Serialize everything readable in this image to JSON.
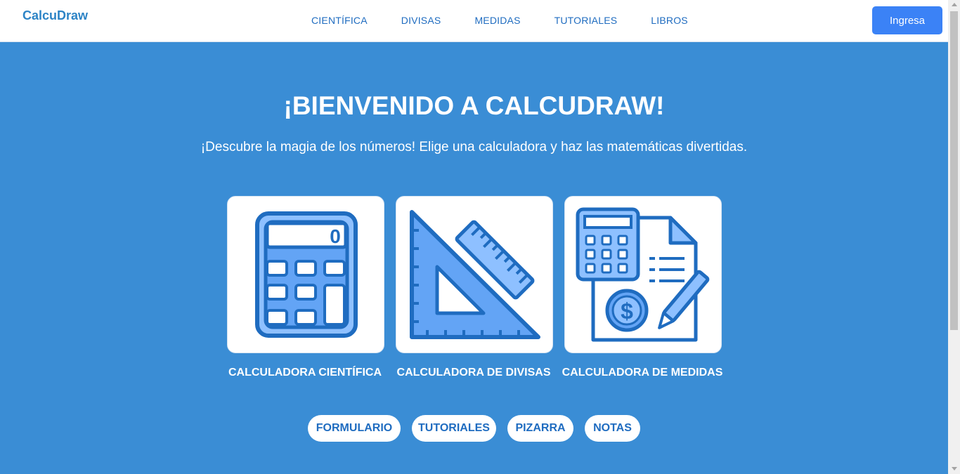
{
  "brand": "CalcuDraw",
  "nav": [
    "CIENTÍFICA",
    "DIVISAS",
    "MEDIDAS",
    "TUTORIALES",
    "LIBROS"
  ],
  "login_label": "Ingresa",
  "hero": {
    "title": "¡BIENVENIDO A CALCUDRAW!",
    "subtitle": "¡Descubre la magia de los números! Elige una calculadora y haz las matemáticas divertidas."
  },
  "cards": [
    {
      "label": "CALCULADORA CIENTÍFICA",
      "icon": "calculator-icon",
      "display": "0"
    },
    {
      "label": "CALCULADORA DE DIVISAS",
      "icon": "set-square-ruler-icon"
    },
    {
      "label": "CALCULADORA DE MEDIDAS",
      "icon": "calculator-document-icon",
      "symbol": "$"
    }
  ],
  "pills": [
    "FORMULARIO",
    "TUTORIALES",
    "PIZARRA",
    "NOTAS"
  ],
  "colors": {
    "background": "#3a8dd5",
    "accent": "#3b82f6",
    "icon_dark": "#1f6cc0",
    "icon_light": "#8ec0ff"
  }
}
